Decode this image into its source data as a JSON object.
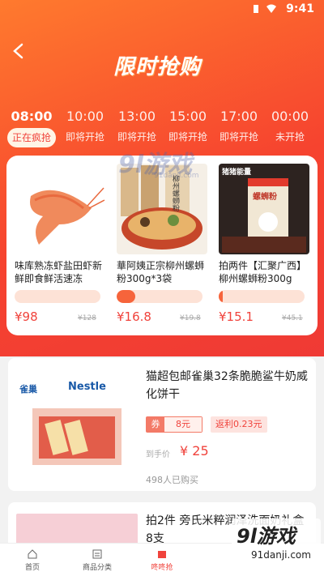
{
  "status": {
    "time": "9:41"
  },
  "header": {
    "title": "限时抢购"
  },
  "tabs": [
    {
      "time": "08:00",
      "state": "正在疯抢",
      "active": true
    },
    {
      "time": "10:00",
      "state": "即将开抢"
    },
    {
      "time": "13:00",
      "state": "即将开抢"
    },
    {
      "time": "15:00",
      "state": "即将开抢"
    },
    {
      "time": "17:00",
      "state": "即将开抢"
    },
    {
      "time": "00:00",
      "state": "未开抢"
    }
  ],
  "flash_items": [
    {
      "name": "味库熟冻虾盐田虾新鲜即食鲜活速冻",
      "price": "¥98",
      "old_price": "¥128",
      "progress": 0.0
    },
    {
      "name": "華阿姨正宗柳州螺蛳粉300g*3袋",
      "price": "¥16.8",
      "old_price": "¥19.8",
      "progress": 0.22,
      "image_text": "柳州螺蛳粉"
    },
    {
      "name": "拍两件【汇聚广西】柳州螺蛳粉300g",
      "price": "¥15.1",
      "old_price": "¥45.1",
      "progress": 0.05,
      "image_text": "螺蛳粉",
      "image_brand": "猪猪能量"
    }
  ],
  "products": [
    {
      "title": "猫超包邮雀巢32条脆脆鲨牛奶威化饼干",
      "coupon_tag": "券",
      "coupon_value": "8元",
      "rebate": "返利0.23元",
      "hand_label": "到手价",
      "hand_price": "¥ 25",
      "bought": "498人已购买",
      "brand1": "雀巢",
      "brand2": "Nestle"
    },
    {
      "title": "拍2件 旁氏米粹润泽洗面奶礼盒8支"
    }
  ],
  "nav": [
    {
      "label": "首页",
      "icon": "home-icon"
    },
    {
      "label": "商品分类",
      "icon": "category-icon"
    },
    {
      "label": "咚咚抢",
      "icon": "flash-sale-icon",
      "active": true
    }
  ],
  "watermark": {
    "mid": "9l游戏",
    "mid_sub": "91danji.com",
    "big": "9l游戏",
    "small": "91danji.com"
  },
  "colors": {
    "accent": "#f0433c",
    "header_top": "#ff7a2e"
  }
}
